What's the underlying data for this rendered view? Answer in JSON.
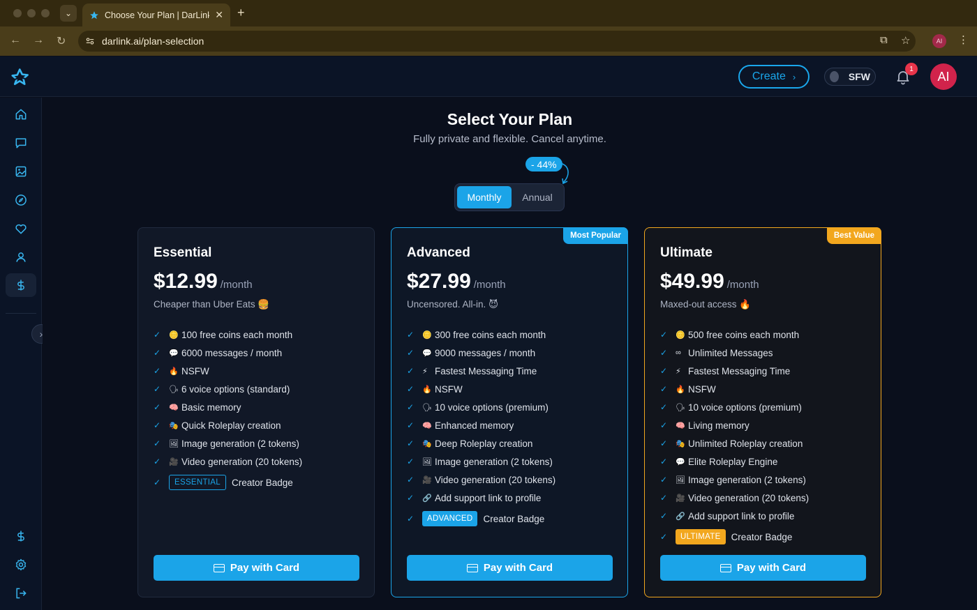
{
  "browser": {
    "tab_title": "Choose Your Plan | DarLink",
    "url": "darlink.ai/plan-selection",
    "profile_initials": "AI"
  },
  "header": {
    "create_label": "Create",
    "sfw_label": "SFW",
    "notification_count": "1",
    "avatar_initials": "AI"
  },
  "page": {
    "title": "Select Your Plan",
    "subtitle": "Fully private and flexible. Cancel anytime.",
    "discount": "- 44%",
    "billing": {
      "monthly": "Monthly",
      "annual": "Annual",
      "selected": "Monthly"
    }
  },
  "plans": [
    {
      "name": "Essential",
      "price": "$12.99",
      "period": "/month",
      "tagline": "Cheaper than Uber Eats 🍔",
      "features": [
        {
          "icon": "🪙",
          "text": "100 free coins each month"
        },
        {
          "icon": "💬",
          "text": "6000 messages / month"
        },
        {
          "icon": "🔥",
          "text": "NSFW"
        },
        {
          "icon": "🗣",
          "text": "6 voice options (standard)"
        },
        {
          "icon": "🧠",
          "text": "Basic memory"
        },
        {
          "icon": "🎭",
          "text": "Quick Roleplay creation"
        },
        {
          "icon": "🖼",
          "text": "Image generation (2 tokens)"
        },
        {
          "icon": "🎥",
          "text": "Video generation (20 tokens)"
        }
      ],
      "badge": "ESSENTIAL",
      "badge_text": "Creator Badge",
      "button": "Pay with Card"
    },
    {
      "name": "Advanced",
      "ribbon": "Most Popular",
      "price": "$27.99",
      "period": "/month",
      "tagline": "Uncensored. All-in. 😈",
      "features": [
        {
          "icon": "🪙",
          "text": "300 free coins each month"
        },
        {
          "icon": "💬",
          "text": "9000 messages / month"
        },
        {
          "icon": "⚡",
          "text": "Fastest Messaging Time"
        },
        {
          "icon": "🔥",
          "text": "NSFW"
        },
        {
          "icon": "🗣",
          "text": "10 voice options (premium)"
        },
        {
          "icon": "🧠",
          "text": "Enhanced memory"
        },
        {
          "icon": "🎭",
          "text": "Deep Roleplay creation"
        },
        {
          "icon": "🖼",
          "text": "Image generation (2 tokens)"
        },
        {
          "icon": "🎥",
          "text": "Video generation (20 tokens)"
        },
        {
          "icon": "🔗",
          "text": "Add support link to profile"
        }
      ],
      "badge": "ADVANCED",
      "badge_text": "Creator Badge",
      "button": "Pay with Card"
    },
    {
      "name": "Ultimate",
      "ribbon": "Best Value",
      "price": "$49.99",
      "period": "/month",
      "tagline": "Maxed-out access 🔥",
      "features": [
        {
          "icon": "🪙",
          "text": "500 free coins each month"
        },
        {
          "icon": "∞",
          "text": "Unlimited Messages"
        },
        {
          "icon": "⚡",
          "text": "Fastest Messaging Time"
        },
        {
          "icon": "🔥",
          "text": "NSFW"
        },
        {
          "icon": "🗣",
          "text": "10 voice options (premium)"
        },
        {
          "icon": "🧠",
          "text": "Living memory"
        },
        {
          "icon": "🎭",
          "text": "Unlimited Roleplay creation"
        },
        {
          "icon": "💬",
          "text": "Elite Roleplay Engine"
        },
        {
          "icon": "🖼",
          "text": "Image generation (2 tokens)"
        },
        {
          "icon": "🎥",
          "text": "Video generation (20 tokens)"
        },
        {
          "icon": "🔗",
          "text": "Add support link to profile"
        }
      ],
      "badge": "ULTIMATE",
      "badge_text": "Creator Badge",
      "button": "Pay with Card"
    }
  ],
  "colors": {
    "accent": "#1ba4e8",
    "gold": "#f2a71e",
    "background": "#0a0f1c",
    "avatar": "#d1234b"
  }
}
